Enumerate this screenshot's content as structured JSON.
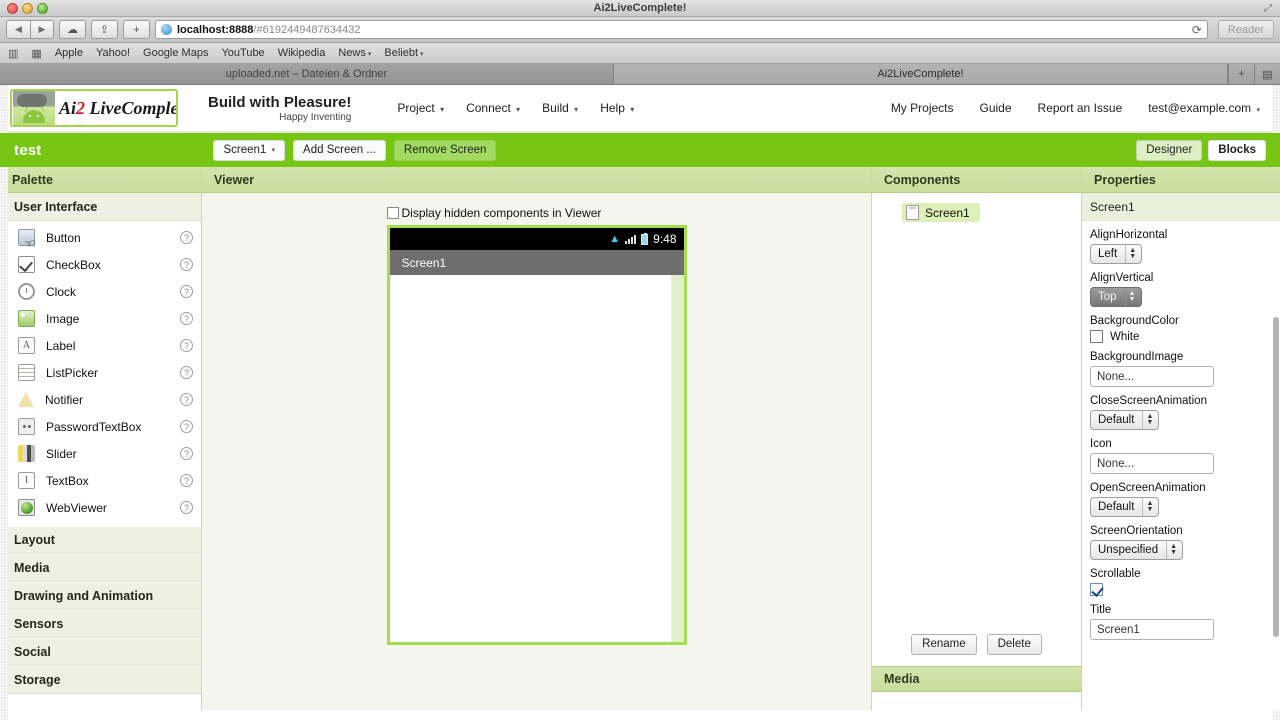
{
  "window": {
    "title": "Ai2LiveComplete!",
    "expand_icon": "expand-icon"
  },
  "browser": {
    "back_icon": "◀",
    "forward_icon": "▶",
    "cloud_icon": "☁",
    "share_icon": "⇪",
    "add_tab_label": "+",
    "url_host": "localhost:8888",
    "url_path": "/#6192449487634432",
    "reload_icon": "⟳",
    "reader_label": "Reader",
    "bookmarks_icon": "book-icon",
    "grid_icon": "grid-icon",
    "bookmarks": [
      {
        "label": "Apple",
        "has_caret": false
      },
      {
        "label": "Yahoo!",
        "has_caret": false
      },
      {
        "label": "Google Maps",
        "has_caret": false
      },
      {
        "label": "YouTube",
        "has_caret": false
      },
      {
        "label": "Wikipedia",
        "has_caret": false
      },
      {
        "label": "News",
        "has_caret": true
      },
      {
        "label": "Beliebt",
        "has_caret": true
      }
    ],
    "tabs": [
      {
        "label": "uploaded.net – Dateien & Ordner",
        "active": false
      },
      {
        "label": "Ai2LiveComplete!",
        "active": true
      }
    ],
    "tab_new_icon": "+",
    "tab_list_icon": "▤"
  },
  "app": {
    "logo_text_pre": "Ai",
    "logo_text_two": "2",
    "logo_text_post": " LiveComplete!",
    "tagline_main": "Build with Pleasure!",
    "tagline_sub": "Happy Inventing",
    "menus": [
      {
        "label": "Project",
        "caret": "▾"
      },
      {
        "label": "Connect",
        "caret": "▾"
      },
      {
        "label": "Build",
        "caret": "▾"
      },
      {
        "label": "Help",
        "caret": "▾"
      }
    ],
    "header_right": [
      {
        "label": "My Projects",
        "caret": ""
      },
      {
        "label": "Guide",
        "caret": ""
      },
      {
        "label": "Report an Issue",
        "caret": ""
      },
      {
        "label": "test@example.com",
        "caret": "▾"
      }
    ]
  },
  "projectbar": {
    "project_name": "test",
    "screen_select": "Screen1",
    "screen_select_caret": "▾",
    "add_screen": "Add Screen ...",
    "remove_screen": "Remove Screen",
    "designer": "Designer",
    "blocks": "Blocks"
  },
  "palette": {
    "title": "Palette",
    "section": "User Interface",
    "help_glyph": "?",
    "items": [
      {
        "label": "Button",
        "icon": "button-icon"
      },
      {
        "label": "CheckBox",
        "icon": "checkbox-icon"
      },
      {
        "label": "Clock",
        "icon": "clock-icon"
      },
      {
        "label": "Image",
        "icon": "image-icon"
      },
      {
        "label": "Label",
        "icon": "label-icon"
      },
      {
        "label": "ListPicker",
        "icon": "listpicker-icon"
      },
      {
        "label": "Notifier",
        "icon": "notifier-icon"
      },
      {
        "label": "PasswordTextBox",
        "icon": "password-icon"
      },
      {
        "label": "Slider",
        "icon": "slider-icon"
      },
      {
        "label": "TextBox",
        "icon": "textbox-icon"
      },
      {
        "label": "WebViewer",
        "icon": "webviewer-icon"
      }
    ],
    "categories": [
      "Layout",
      "Media",
      "Drawing and Animation",
      "Sensors",
      "Social",
      "Storage"
    ]
  },
  "viewer": {
    "title": "Viewer",
    "hidden_components_label": "Display hidden components in Viewer",
    "phone": {
      "status_time": "9:48",
      "wifi_icon": "wifi-icon",
      "signal_icon": "signal-icon",
      "battery_icon": "battery-icon",
      "screen_title": "Screen1"
    }
  },
  "components": {
    "title": "Components",
    "tree": [
      {
        "label": "Screen1",
        "icon": "screen-icon",
        "selected": true
      }
    ],
    "rename": "Rename",
    "delete": "Delete",
    "media_title": "Media"
  },
  "properties": {
    "title": "Properties",
    "selected_component": "Screen1",
    "fields": [
      {
        "name": "AlignHorizontal",
        "type": "select",
        "value": "Left",
        "pressed": false
      },
      {
        "name": "AlignVertical",
        "type": "select",
        "value": "Top",
        "pressed": true
      },
      {
        "name": "BackgroundColor",
        "type": "color",
        "value": "White",
        "swatch": "#ffffff"
      },
      {
        "name": "BackgroundImage",
        "type": "text",
        "value": "None..."
      },
      {
        "name": "CloseScreenAnimation",
        "type": "select",
        "value": "Default",
        "pressed": false
      },
      {
        "name": "Icon",
        "type": "text",
        "value": "None..."
      },
      {
        "name": "OpenScreenAnimation",
        "type": "select",
        "value": "Default",
        "pressed": false
      },
      {
        "name": "ScreenOrientation",
        "type": "select",
        "value": "Unspecified",
        "pressed": false
      },
      {
        "name": "Scrollable",
        "type": "checkbox",
        "value": "checked"
      },
      {
        "name": "Title",
        "type": "text",
        "value": "Screen1"
      }
    ]
  },
  "colors": {
    "accent_green": "#78c614",
    "panel_header_green": "#c7dd9c",
    "section_bg": "#eef1e2",
    "phone_border": "#a6dd4e",
    "selection_green": "#ddf0b6"
  }
}
